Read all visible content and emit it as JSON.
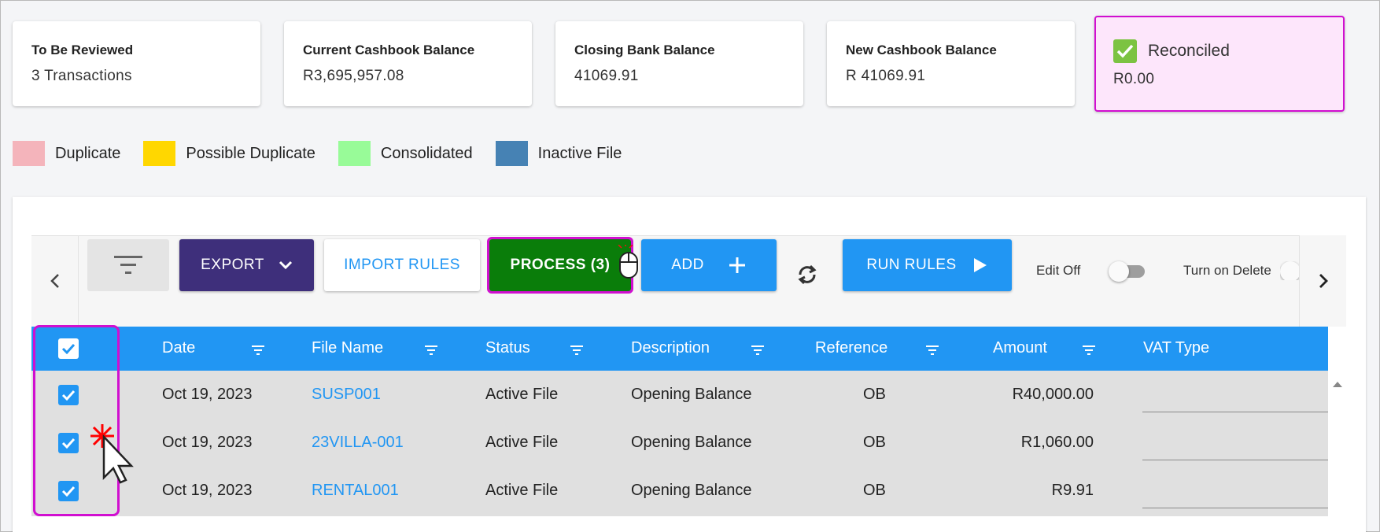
{
  "cards": [
    {
      "label": "To Be Reviewed",
      "value": "3 Transactions"
    },
    {
      "label": "Current Cashbook Balance",
      "value": "R3,695,957.08"
    },
    {
      "label": "Closing Bank Balance",
      "value": "41069.91"
    },
    {
      "label": "New Cashbook Balance",
      "value": "R 41069.91"
    }
  ],
  "reconciled": {
    "label": "Reconciled",
    "value": "R0.00",
    "check_color": "#7cc342"
  },
  "legend": [
    {
      "label": "Duplicate",
      "color": "#f4b4bb"
    },
    {
      "label": "Possible Duplicate",
      "color": "#ffd700"
    },
    {
      "label": "Consolidated",
      "color": "#98fb98"
    },
    {
      "label": "Inactive File",
      "color": "#4682b4"
    }
  ],
  "toolbar": {
    "export_label": "EXPORT",
    "import_label": "IMPORT RULES",
    "process_label": "PROCESS (3)",
    "add_label": "ADD",
    "run_label": "RUN RULES",
    "edit_label": "Edit Off",
    "delete_label": "Turn on Delete"
  },
  "table": {
    "headers": {
      "date": "Date",
      "file_name": "File Name",
      "status": "Status",
      "description": "Description",
      "reference": "Reference",
      "amount": "Amount",
      "vat_type": "VAT Type"
    },
    "rows": [
      {
        "date": "Oct 19, 2023",
        "file_name": "SUSP001",
        "status": "Active File",
        "description": "Opening Balance",
        "reference": "OB",
        "amount": "R40,000.00"
      },
      {
        "date": "Oct 19, 2023",
        "file_name": "23VILLA-001",
        "status": "Active File",
        "description": "Opening Balance",
        "reference": "OB",
        "amount": "R1,060.00"
      },
      {
        "date": "Oct 19, 2023",
        "file_name": "RENTAL001",
        "status": "Active File",
        "description": "Opening Balance",
        "reference": "OB",
        "amount": "R9.91"
      }
    ]
  },
  "colors": {
    "header_blue": "#2196f3",
    "export_purple": "#3e2f7b",
    "process_green": "#0a7d0a",
    "highlight_magenta": "#d10fd0"
  }
}
